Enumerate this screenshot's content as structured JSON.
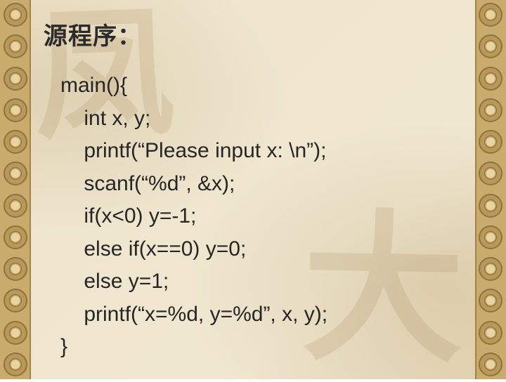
{
  "heading": "源程序：",
  "code_lines": [
    "main(){",
    "    int x, y;",
    "    printf(“Please input x: \\n”);",
    "    scanf(“%d”, &x);",
    "    if(x<0) y=-1;",
    "    else if(x==0) y=0;",
    "    else y=1;",
    "    printf(“x=%d, y=%d”, x, y);",
    "}"
  ],
  "watermark_glyphs": {
    "wm1": "凤",
    "wm2": "大"
  },
  "coin_count_per_side": 12
}
